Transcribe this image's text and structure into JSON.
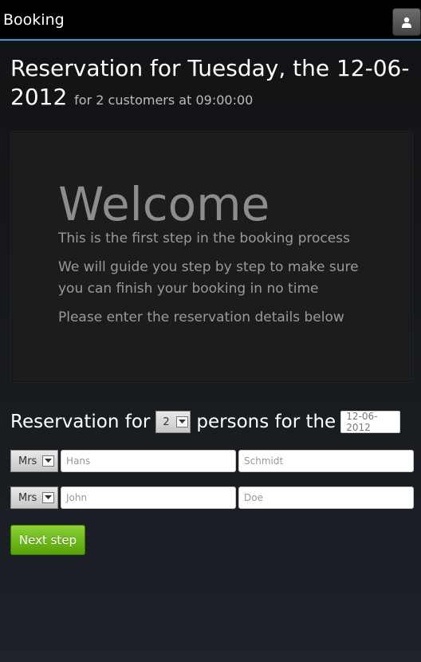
{
  "nav": {
    "brand": "Booking",
    "user_icon": "user-icon"
  },
  "header": {
    "title": "Reservation for Tuesday, the 12-06-2012",
    "subtitle": "for 2 customers at 09:00:00"
  },
  "hero": {
    "title": "Welcome",
    "line1": "This is the first step in the booking process",
    "line2": "We will guide you step by step to make sure you can finish your booking in no time",
    "line3": "Please enter the reservation details below"
  },
  "form": {
    "prefix": "Reservation for",
    "count": "2",
    "middle": "persons for the",
    "date": "12-06-2012",
    "persons": [
      {
        "title": "Mrs",
        "first_placeholder": "Hans",
        "last_placeholder": "Schmidt"
      },
      {
        "title": "Mrs",
        "first_placeholder": "John",
        "last_placeholder": "Doe"
      }
    ],
    "next_label": "Next step"
  },
  "colors": {
    "accent": "#2a9fd6",
    "button_green": "#6cba1b"
  }
}
